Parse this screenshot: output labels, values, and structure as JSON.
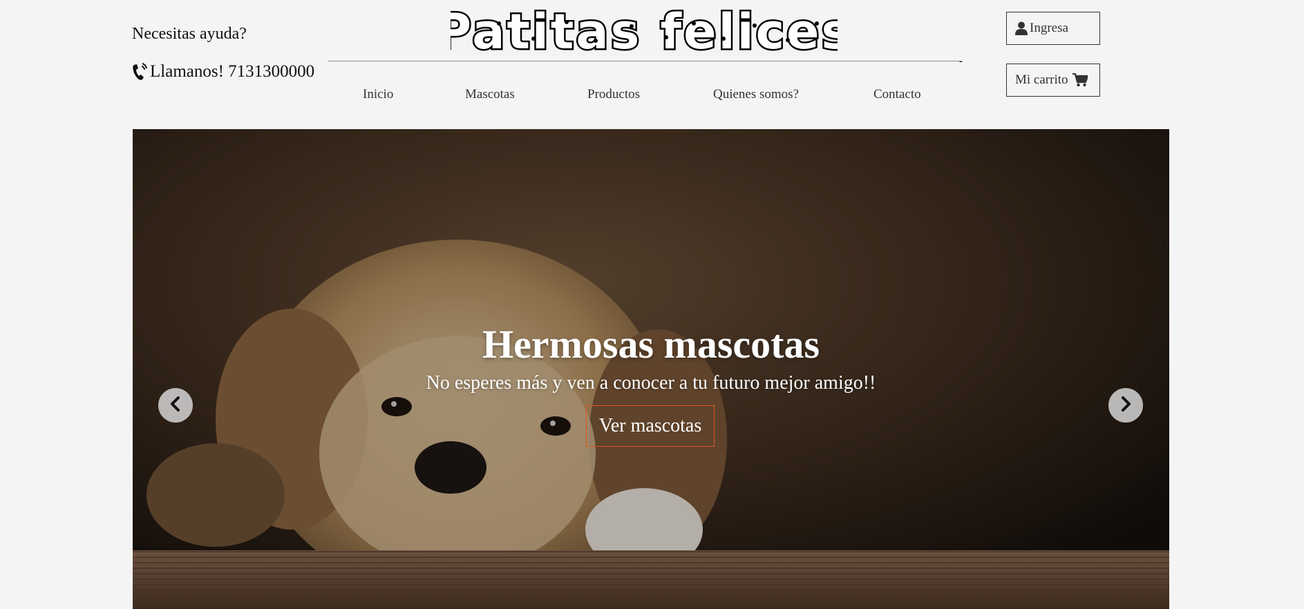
{
  "header": {
    "help_text": "Necesitas ayuda?",
    "phone_text": "Llamanos! 7131300000",
    "logo_text": "Patitas felices",
    "rule_dash": "-"
  },
  "nav": {
    "items": [
      {
        "label": "Inicio"
      },
      {
        "label": "Mascotas"
      },
      {
        "label": "Productos"
      },
      {
        "label": "Quienes somos?"
      },
      {
        "label": "Contacto"
      }
    ]
  },
  "account": {
    "login_label": "Ingresa",
    "cart_label": "Mi carrito"
  },
  "hero": {
    "title": "Hermosas mascotas",
    "subtitle": "No esperes más y ven a conocer a tu futuro mejor amigo!!",
    "cta_label": "Ver mascotas"
  },
  "icons": {
    "phone": "phone-icon",
    "user": "user-icon",
    "cart": "shopping-cart-icon",
    "prev": "chevron-left-icon",
    "next": "chevron-right-icon"
  },
  "colors": {
    "page_background": "#f4f4f4",
    "cta_border": "#e2541f",
    "hero_text": "#ffffff"
  }
}
